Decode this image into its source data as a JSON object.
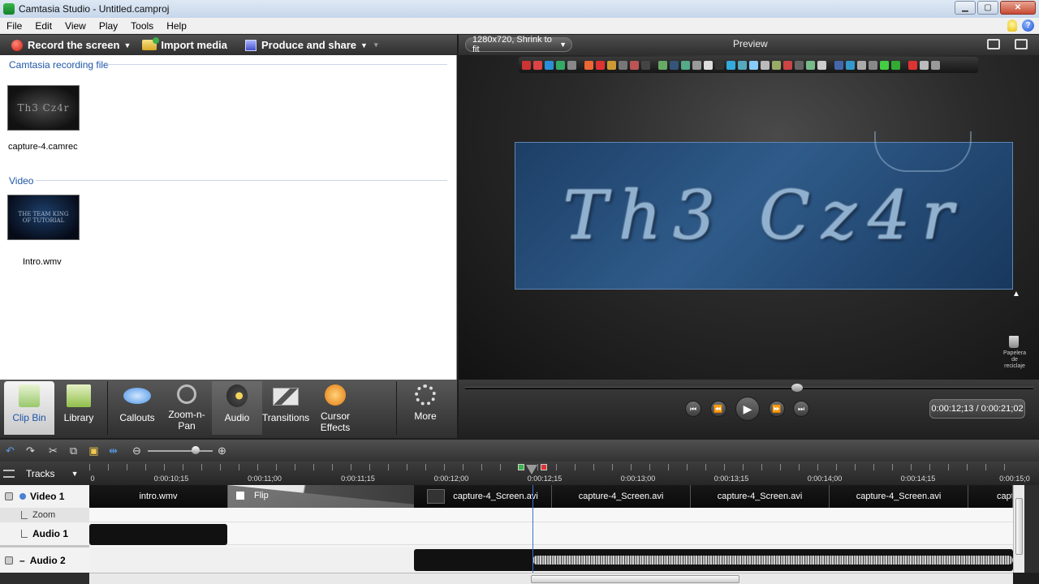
{
  "window": {
    "title": "Camtasia Studio - Untitled.camproj"
  },
  "menu": [
    "File",
    "Edit",
    "View",
    "Play",
    "Tools",
    "Help"
  ],
  "toolbar": {
    "record": "Record the screen",
    "import": "Import media",
    "produce": "Produce and share"
  },
  "clipbin": {
    "section1": "Camtasia recording file",
    "thumb1_text": "Th3 Cz4r",
    "file1": "capture-4.camrec",
    "section2": "Video",
    "thumb2_line1": "THE TEAM KING",
    "thumb2_line2": "OF TUTORIAL",
    "file2": "Intro.wmv"
  },
  "preview": {
    "size": "1280x720, Shrink to fit",
    "label": "Preview",
    "banner_text": "Th3 Cz4r",
    "desktop_icon_label": "Papelera de reciclaje"
  },
  "tasks": [
    {
      "label": "Clip Bin",
      "icon": "clip-bin-icon"
    },
    {
      "label": "Library",
      "icon": "library-icon"
    },
    {
      "label": "Callouts",
      "icon": "callouts-icon"
    },
    {
      "label": "Zoom-n-Pan",
      "icon": "zoom-icon"
    },
    {
      "label": "Audio",
      "icon": "speaker-icon"
    },
    {
      "label": "Transitions",
      "icon": "transitions-icon"
    },
    {
      "label": "Cursor Effects",
      "icon": "cursor-effects-icon"
    },
    {
      "label": "More",
      "icon": "more-icon"
    }
  ],
  "playback": {
    "timecode": "0:00:12;13 / 0:00:21;02"
  },
  "timeline": {
    "tracks_label": "Tracks",
    "ruler": [
      "0",
      "0:00:10;15",
      "0:00:11;00",
      "0:00:11;15",
      "0:00:12;00",
      "0:00:12;15",
      "0:00:13;00",
      "0:00:13;15",
      "0:00:14;00",
      "0:00:14;15",
      "0:00:15;0"
    ],
    "track_names": {
      "video": "Video 1",
      "zoom": "Zoom",
      "audio1": "Audio 1",
      "audio2": "Audio 2"
    },
    "clips": [
      "intro.wmv",
      "Flip",
      "capture-4_Screen.avi",
      "capture-4_Screen.avi",
      "capture-4_Screen.avi",
      "capture-4_Screen.avi",
      "capt"
    ]
  },
  "colors": {
    "accent": "#1f56a8",
    "playhead": "#3c74c8"
  }
}
